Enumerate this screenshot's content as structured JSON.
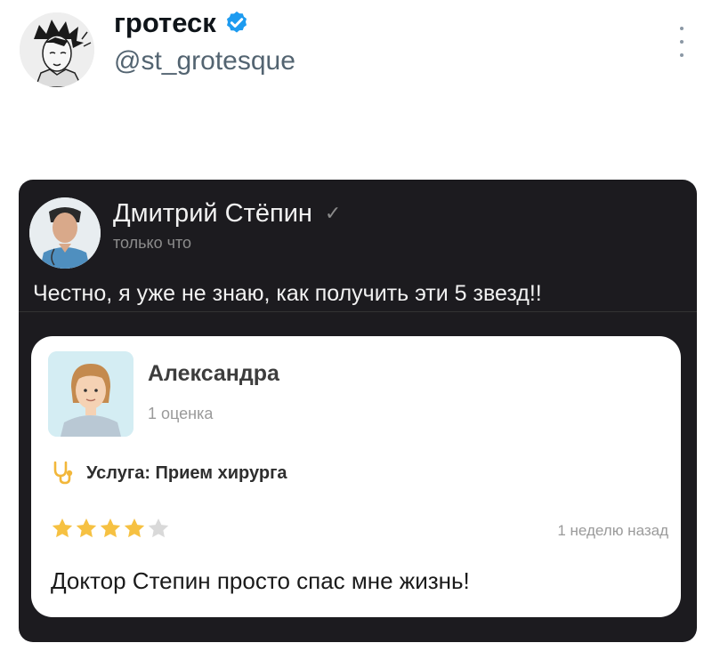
{
  "tweet": {
    "author_name": "гротеск",
    "author_handle": "@st_grotesque",
    "verified_badge_icon": "verified-badge-icon",
    "more_icon": "more-options-icon"
  },
  "media": {
    "post": {
      "author": "Дмитрий Стёпин",
      "check_icon": "checkmark-icon",
      "time": "только что",
      "text": "Честно, я уже не знаю, как получить эти 5 звезд!!"
    },
    "review": {
      "reviewer_name": "Александра",
      "reviewer_count": "1 оценка",
      "service_icon": "stethoscope-icon",
      "service": "Услуга: Прием хирурга",
      "rating": 4,
      "rating_max": 5,
      "time": "1 неделю назад",
      "text": "Доктор Степин просто спас мне жизнь!"
    }
  },
  "colors": {
    "accent_blue": "#1d9bf0",
    "star_gold": "#f6c142",
    "star_empty": "#d9d9d9",
    "card_dark": "#1c1b1f"
  }
}
